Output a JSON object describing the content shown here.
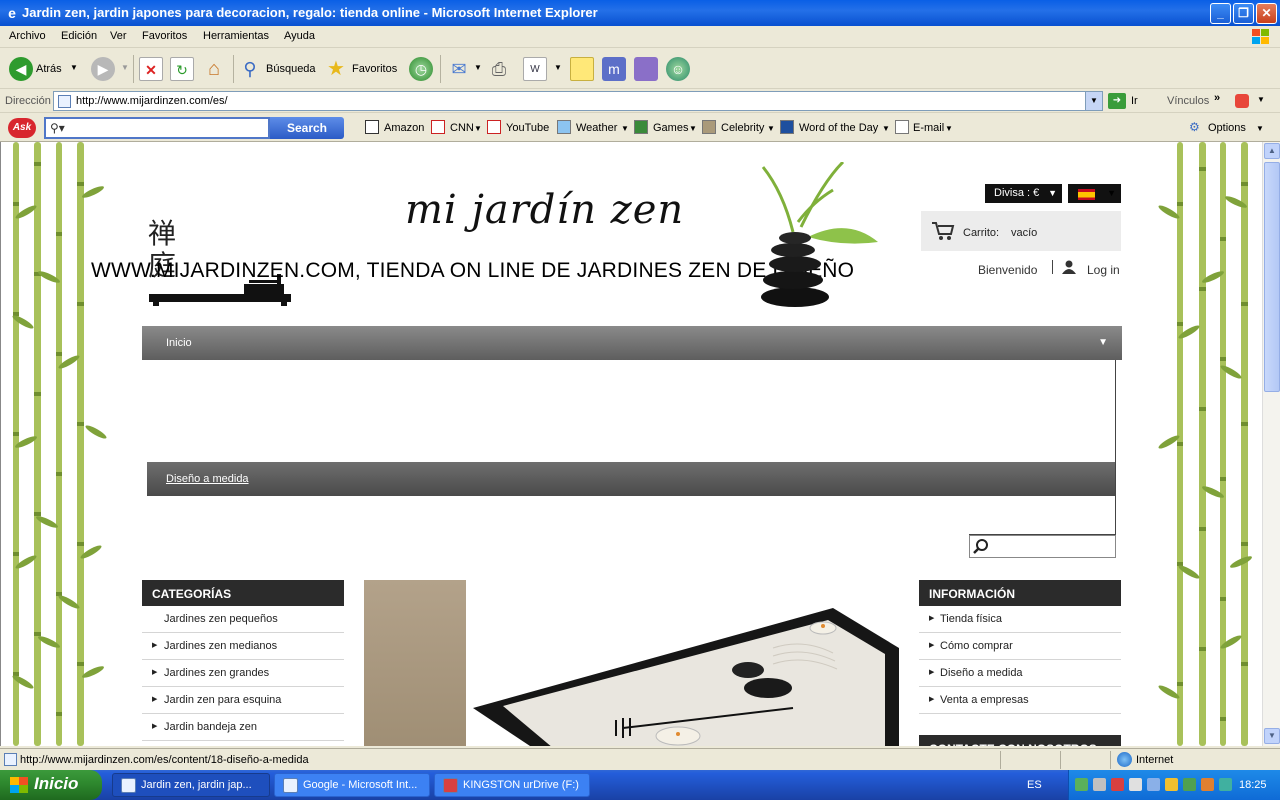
{
  "window": {
    "title": "Jardin zen, jardin japones para decoracion, regalo: tienda online - Microsoft Internet Explorer"
  },
  "menu": [
    "Archivo",
    "Edición",
    "Ver",
    "Favoritos",
    "Herramientas",
    "Ayuda"
  ],
  "toolbar": {
    "back_label": "Atrás",
    "search_label": "Búsqueda",
    "favorites_label": "Favoritos"
  },
  "address": {
    "label": "Dirección",
    "url": "http://www.mijardinzen.com/es/",
    "go_label": "Ir",
    "links_label": "Vínculos"
  },
  "ask": {
    "search_button": "Search",
    "links": [
      "Amazon",
      "CNN",
      "YouTube",
      "Weather",
      "Games",
      "Celebrity",
      "Word of the Day",
      "E-mail"
    ],
    "options_label": "Options"
  },
  "page": {
    "logo": "mi jardín zen",
    "kanji_1": "禅",
    "kanji_2": "庭",
    "tagline": "WWW.MIJARDINZEN.COM, TIENDA ON LINE DE JARDINES ZEN DE DISEÑO",
    "currency": "Divisa : €",
    "cart_label": "Carrito:",
    "cart_status": "vacío",
    "welcome": "Bienvenido",
    "login": "Log in",
    "nav_home": "Inicio",
    "sub_link": "Diseño a medida",
    "categories_title": "CATEGORÍAS",
    "categories": [
      "Jardines zen pequeños",
      "Jardines zen medianos",
      "Jardines zen grandes",
      "Jardin zen para esquina",
      "Jardin bandeja zen"
    ],
    "info_title": "INFORMACIÓN",
    "info_items": [
      "Tienda física",
      "Cómo comprar",
      "Diseño a medida",
      "Venta a empresas"
    ],
    "contact_title": "CONTACTE CON NOSOTROS"
  },
  "status": {
    "text": "http://www.mijardinzen.com/es/content/18-diseño-a-medida",
    "zone": "Internet"
  },
  "taskbar": {
    "start": "Inicio",
    "tasks": [
      "Jardin zen, jardin jap...",
      "Google - Microsoft Int...",
      "KINGSTON urDrive (F:)"
    ],
    "language": "ES",
    "clock": "18:25"
  },
  "colors": {
    "titlebar": "#0a5fe6",
    "nav": "#6e6e6e",
    "column_header": "#2b2b2b",
    "taskbar": "#245edb",
    "start": "#3c9a3c"
  }
}
